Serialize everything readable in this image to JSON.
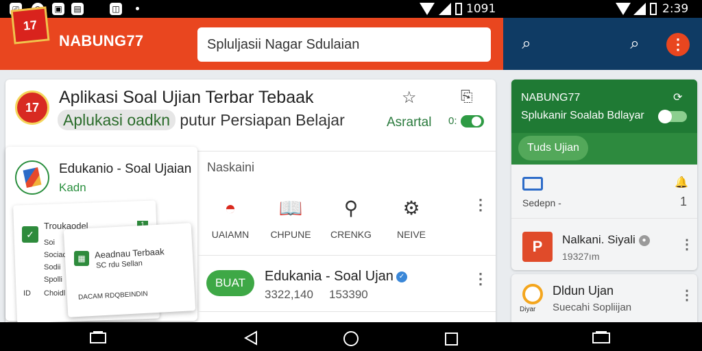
{
  "status_bar": {
    "left_time": "1091",
    "right_time": "2:39",
    "left_icons": [
      "usb-icon",
      "chrome-icon",
      "gallery-icon",
      "screenshot-icon",
      "nfc-icon"
    ]
  },
  "app_bar": {
    "logo_text": "17",
    "title": "NABUNG77",
    "search_value": "Spluljasii Nagar Sdulaian"
  },
  "main_card": {
    "logo_text": "17",
    "title": "Aplikasi Soal Ujian Terbar Tebaak",
    "subtitle_pill": "Aplukasi oadkn",
    "subtitle_rest": " putur Persiapan Belajar",
    "status_text": "Asrartal",
    "toggle_label": "0:"
  },
  "nested_card": {
    "title": "Edukanio - Soal Ujaian",
    "subtitle": "Kadn",
    "mini1": {
      "header": "Troukaodel",
      "badge": "1",
      "lines": [
        "Soi",
        "Sociad",
        "Sodii",
        "Spolli"
      ],
      "footer_left": "ID",
      "footer_right": "Choidl"
    },
    "mini2": {
      "title": "Aeadnau Terbaak",
      "subtitle": "SC rdu Sellan",
      "footer": "DACAM RDQBEINDIN"
    }
  },
  "categories": {
    "section_label": "Naskaini",
    "items": [
      {
        "label": "UAIAMN",
        "icon": "helmet-icon"
      },
      {
        "label": "CHPUNE",
        "icon": "book-icon"
      },
      {
        "label": "CRENKG",
        "icon": "search-icon"
      },
      {
        "label": "NEIVE",
        "icon": "gear-icon"
      }
    ]
  },
  "app_row": {
    "button_label": "BUAT",
    "title": "Edukania - Soal Ujan",
    "meta_left": "3322,140",
    "meta_right": "153390"
  },
  "right_panel": {
    "header_title": "NABUNG77",
    "header_subtitle": "Splukanir Soalab Bdlayar",
    "chip_label": "Tuds Ujian",
    "section_text": "Sedepn -",
    "section_count": "1",
    "item1": {
      "icon_letter": "P",
      "title": "Nalkani. Siyali",
      "meta": "19327ım"
    },
    "item2": {
      "icon_label": "Diyar",
      "title": "Dldun Ujan",
      "subtitle": "Suecahi Sopliijan"
    }
  },
  "colors": {
    "app_bar": "#e9461f",
    "app_bar_right": "#0f3b64",
    "green": "#2d8a3e",
    "accent_green": "#3ea846"
  }
}
